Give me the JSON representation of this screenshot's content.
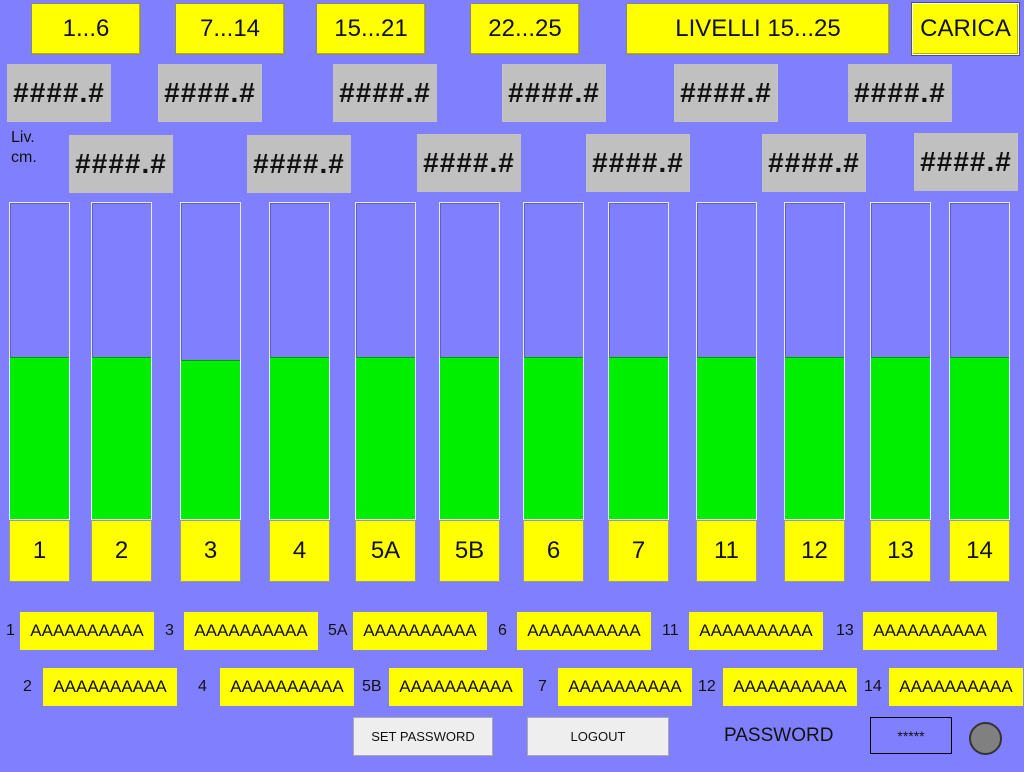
{
  "nav": {
    "btn1": "1...6",
    "btn2": "7...14",
    "btn3": "15...21",
    "btn4": "22...25",
    "levels": "LIVELLI 15...25",
    "load": "CARICA"
  },
  "placeholder_value": "####.#",
  "level_label": "Liv.\ncm.",
  "tanks": [
    {
      "label": "1",
      "level": 0.51
    },
    {
      "label": "2",
      "level": 0.51
    },
    {
      "label": "3",
      "level": 0.5
    },
    {
      "label": "4",
      "level": 0.51
    },
    {
      "label": "5A",
      "level": 0.51
    },
    {
      "label": "5B",
      "level": 0.51
    },
    {
      "label": "6",
      "level": 0.51
    },
    {
      "label": "7",
      "level": 0.51
    },
    {
      "label": "11",
      "level": 0.51
    },
    {
      "label": "12",
      "level": 0.51
    },
    {
      "label": "13",
      "level": 0.51
    },
    {
      "label": "14",
      "level": 0.51
    }
  ],
  "rows": {
    "row1": [
      {
        "label": "1",
        "value": "AAAAAAAAAA"
      },
      {
        "label": "3",
        "value": "AAAAAAAAAA"
      },
      {
        "label": "5A",
        "value": "AAAAAAAAAA"
      },
      {
        "label": "6",
        "value": "AAAAAAAAAA"
      },
      {
        "label": "11",
        "value": "AAAAAAAAAA"
      },
      {
        "label": "13",
        "value": "AAAAAAAAAA"
      }
    ],
    "row2": [
      {
        "label": "2",
        "value": "AAAAAAAAAA"
      },
      {
        "label": "4",
        "value": "AAAAAAAAAA"
      },
      {
        "label": "5B",
        "value": "AAAAAAAAAA"
      },
      {
        "label": "7",
        "value": "AAAAAAAAAA"
      },
      {
        "label": "12",
        "value": "AAAAAAAAAA"
      },
      {
        "label": "14",
        "value": "AAAAAAAAAA"
      }
    ]
  },
  "footer": {
    "set_password": "SET PASSWORD",
    "logout": "LOGOUT",
    "password_label": "PASSWORD",
    "password_value": "*****"
  },
  "colors": {
    "background": "#8080FF",
    "button": "#FFFF00",
    "display": "#C0C0C0",
    "fill": "#00EE00",
    "indicator": "#808080"
  }
}
